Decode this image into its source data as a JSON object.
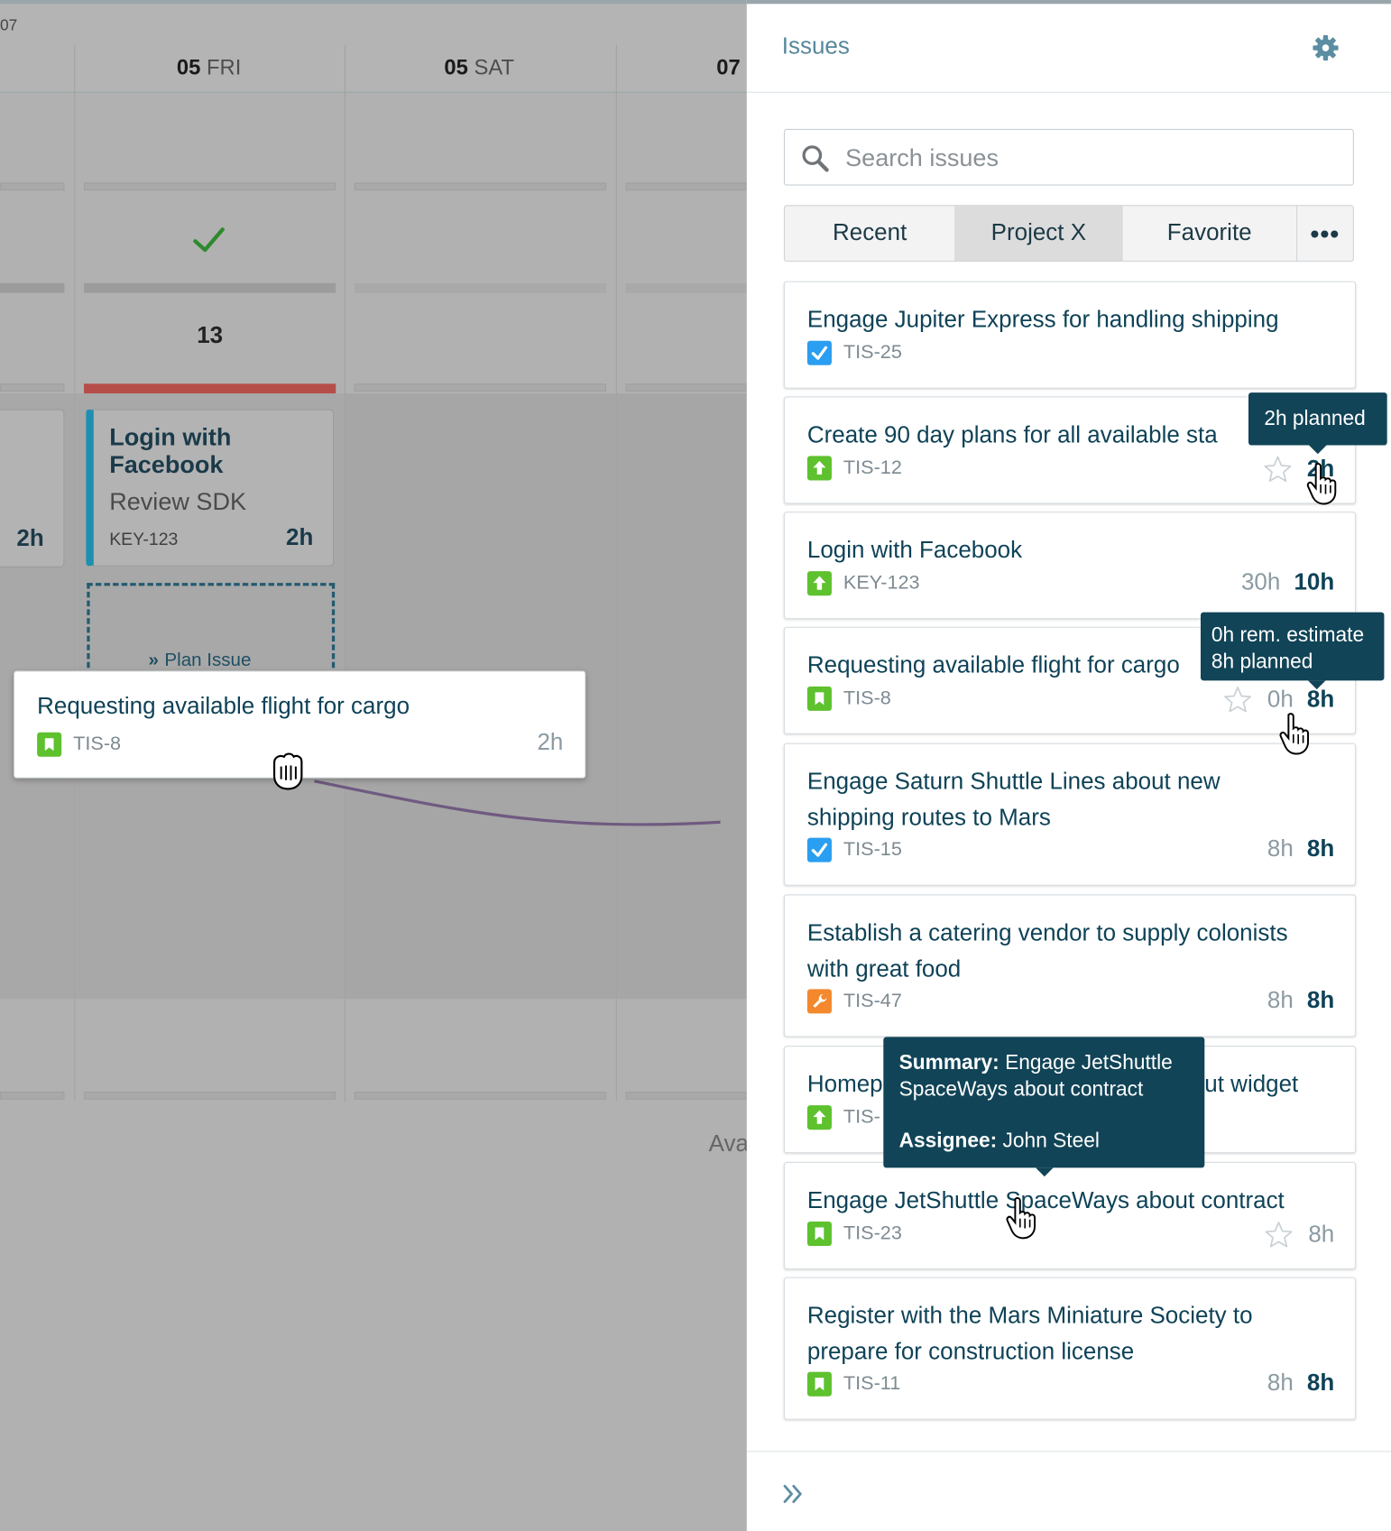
{
  "calendar": {
    "week_label": "07",
    "days": [
      {
        "num": "05",
        "name": "FRI"
      },
      {
        "num": "05",
        "name": "SAT"
      },
      {
        "num": "07",
        "name": ""
      }
    ],
    "day_total": "13",
    "partial_card_hours": "2h",
    "card": {
      "title": "Login with Facebook",
      "subtitle": "Review SDK",
      "key": "KEY-123",
      "hours": "2h"
    },
    "plan_issue_label": "Plan Issue",
    "available_label": "Ava"
  },
  "dragged_card": {
    "title": "Requesting available flight for cargo",
    "key": "TIS-8",
    "hours": "2h"
  },
  "sidebar": {
    "title": "Issues",
    "search_placeholder": "Search issues",
    "tabs": [
      "Recent",
      "Project X",
      "Favorite",
      "•••"
    ],
    "issues": [
      {
        "title": "Engage Jupiter Express for handling shipping",
        "key": "TIS-25",
        "type": "task",
        "estimate": "",
        "planned": ""
      },
      {
        "title": "Create 90 day plans for all available sta",
        "key": "TIS-12",
        "type": "improvement",
        "estimate": "",
        "planned": "2h"
      },
      {
        "title": "Login with Facebook",
        "key": "KEY-123",
        "type": "improvement",
        "estimate": "30h",
        "planned": "10h"
      },
      {
        "title": "Requesting available flight for cargo",
        "key": "TIS-8",
        "type": "story",
        "estimate": "0h",
        "planned": "8h"
      },
      {
        "title": "Engage Saturn Shuttle Lines about new shipping routes to Mars",
        "key": "TIS-15",
        "type": "task",
        "estimate": "8h",
        "planned": "8h"
      },
      {
        "title": "Establish a catering vendor to supply colonists with great food",
        "key": "TIS-47",
        "type": "bug",
        "estimate": "8h",
        "planned": "8h"
      },
      {
        "title_left": "Homep",
        "title_right": "ut widget",
        "key": "TIS-",
        "type": "improvement"
      },
      {
        "title": "Engage JetShuttle SpaceWays about contract",
        "key": "TIS-23",
        "type": "story",
        "estimate": "8h",
        "planned": ""
      },
      {
        "title": "Register with the Mars Miniature Society to prepare for construction license",
        "key": "TIS-11",
        "type": "story",
        "estimate": "8h",
        "planned": "8h"
      }
    ]
  },
  "tooltips": {
    "planned": "2h planned",
    "estimate_line1": "0h rem. estimate",
    "estimate_line2": "8h planned",
    "summary_label": "Summary:",
    "summary_value": "Engage JetShuttle SpaceWays about contract",
    "assignee_label": "Assignee:",
    "assignee_value": "John Steel"
  },
  "colors": {
    "accent": "#0e4257",
    "story": "#5ec12e",
    "task": "#2a9ef0",
    "bug": "#f3892c",
    "tooltip": "#114457"
  }
}
